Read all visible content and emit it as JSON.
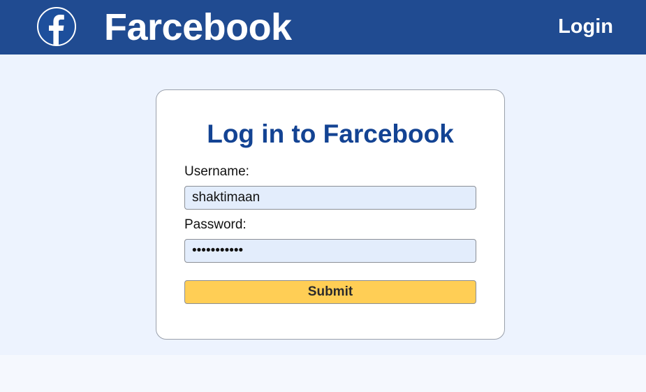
{
  "header": {
    "logo_icon": "facebook-f-logo-icon",
    "brand": "Farcebook",
    "login_link": "Login"
  },
  "login_card": {
    "title": "Log in to Farcebook",
    "username_label": "Username:",
    "username_value": "shaktimaan",
    "password_label": "Password:",
    "password_value": "•••••••••••",
    "submit_label": "Submit"
  },
  "colors": {
    "navbar_bg": "#204b91",
    "page_bg": "#edf3fe",
    "title_color": "#134393",
    "input_bg": "#e3edfc",
    "submit_bg": "#ffce55"
  }
}
